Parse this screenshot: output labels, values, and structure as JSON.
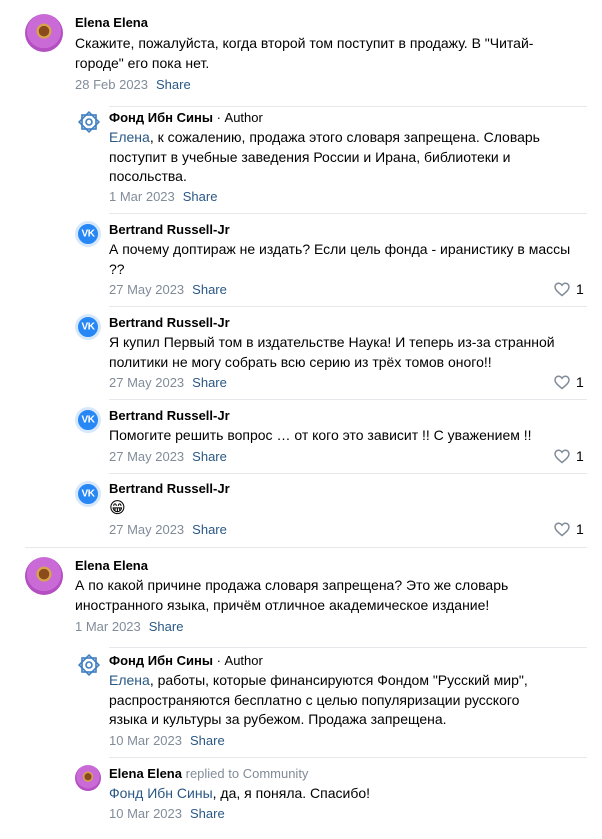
{
  "comments": [
    {
      "author": "Elena Elena",
      "text": "Скажите, пожалуйста, когда второй том поступит в продажу. В \"Читай-городе\" его пока нет.",
      "date": "28 Feb 2023",
      "share": "Share"
    },
    {
      "author": "Фонд Ибн Сины",
      "sep": "·",
      "role": "Author",
      "mention": "Елена",
      "text": ", к сожалению, продажа этого словаря запрещена. Словарь поступит в учебные заведения России и Ирана, библиотеки и посольства.",
      "date": "1 Mar 2023",
      "share": "Share"
    },
    {
      "author": "Bertrand Russell-Jr",
      "text": "А почему доптираж не издать? Если цель фонда - иранистику в массы ??",
      "date": "27 May 2023",
      "share": "Share",
      "likes": "1"
    },
    {
      "author": "Bertrand Russell-Jr",
      "text": "Я купил Первый том в издательстве Наука! И теперь из-за странной политики не могу собрать всю серию из трёх томов оного!!",
      "date": "27 May 2023",
      "share": "Share",
      "likes": "1"
    },
    {
      "author": "Bertrand Russell-Jr",
      "text": "Помогите решить вопрос … от кого это зависит !! С уважением !!",
      "date": "27 May 2023",
      "share": "Share",
      "likes": "1"
    },
    {
      "author": "Bertrand Russell-Jr",
      "text": "😁",
      "date": "27 May 2023",
      "share": "Share",
      "likes": "1"
    },
    {
      "author": "Elena Elena",
      "text": "А по какой причине продажа словаря запрещена? Это же словарь иностранного языка, причём отличное академическое издание!",
      "date": "1 Mar 2023",
      "share": "Share"
    },
    {
      "author": "Фонд Ибн Сины",
      "sep": "·",
      "role": "Author",
      "mention": "Елена",
      "text": ", работы, которые финансируются Фондом \"Русский мир\", распространяются бесплатно с целью популяризации русского языка и культуры за рубежом. Продажа запрещена.",
      "date": "10 Mar 2023",
      "share": "Share"
    },
    {
      "author": "Elena Elena",
      "replied": "replied to Community",
      "mention": "Фонд Ибн Сины",
      "text": ", да, я поняла. Спасибо!",
      "date": "10 Mar 2023",
      "share": "Share"
    }
  ],
  "colors": {
    "link": "#2a5885",
    "meta": "#818c99",
    "vk_blue": "#2787f5",
    "fund_blue": "#3f7fc1"
  },
  "icons": {
    "fund_avatar": "eight-point-star-logo-icon",
    "vk_avatar": "vk-logo-icon",
    "like": "heart-outline-icon"
  }
}
